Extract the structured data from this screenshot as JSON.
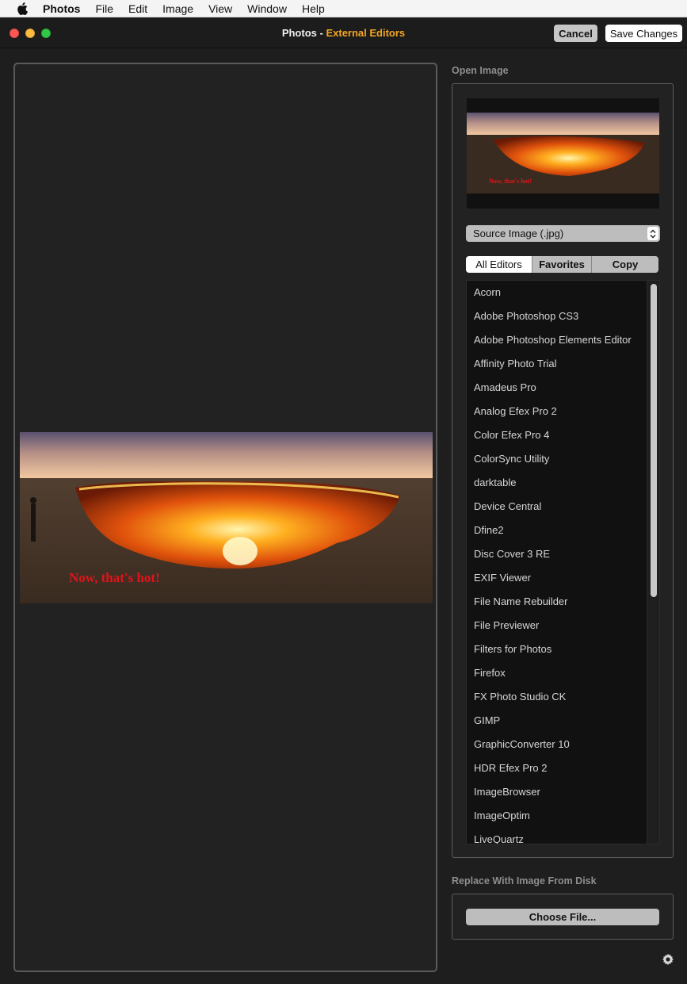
{
  "menubar": {
    "app": "Photos",
    "items": [
      "File",
      "Edit",
      "Image",
      "View",
      "Window",
      "Help"
    ]
  },
  "window": {
    "title_app": "Photos",
    "title_separator": "-",
    "title_sub": "External Editors",
    "cancel_label": "Cancel",
    "save_label": "Save Changes"
  },
  "preview": {
    "caption": "Now, that's hot!"
  },
  "open_image": {
    "label": "Open Image",
    "source_select": "Source Image (.jpg)",
    "tabs": [
      "All Editors",
      "Favorites",
      "Copy"
    ],
    "editors": [
      "Acorn",
      "Adobe Photoshop CS3",
      "Adobe Photoshop Elements Editor",
      "Affinity Photo Trial",
      "Amadeus Pro",
      "Analog Efex Pro 2",
      "Color Efex Pro 4",
      "ColorSync Utility",
      "darktable",
      "Device Central",
      "Dfine2",
      "Disc Cover 3 RE",
      "EXIF Viewer",
      "File Name Rebuilder",
      "File Previewer",
      "Filters for Photos",
      "Firefox",
      "FX Photo Studio CK",
      "GIMP",
      "GraphicConverter 10",
      "HDR Efex Pro 2",
      "ImageBrowser",
      "ImageOptim",
      "LiveQuartz"
    ]
  },
  "replace": {
    "label": "Replace With Image From Disk",
    "choose_label": "Choose File..."
  },
  "colors": {
    "title_accent": "#f5a623",
    "caption_red": "#e0141b"
  }
}
